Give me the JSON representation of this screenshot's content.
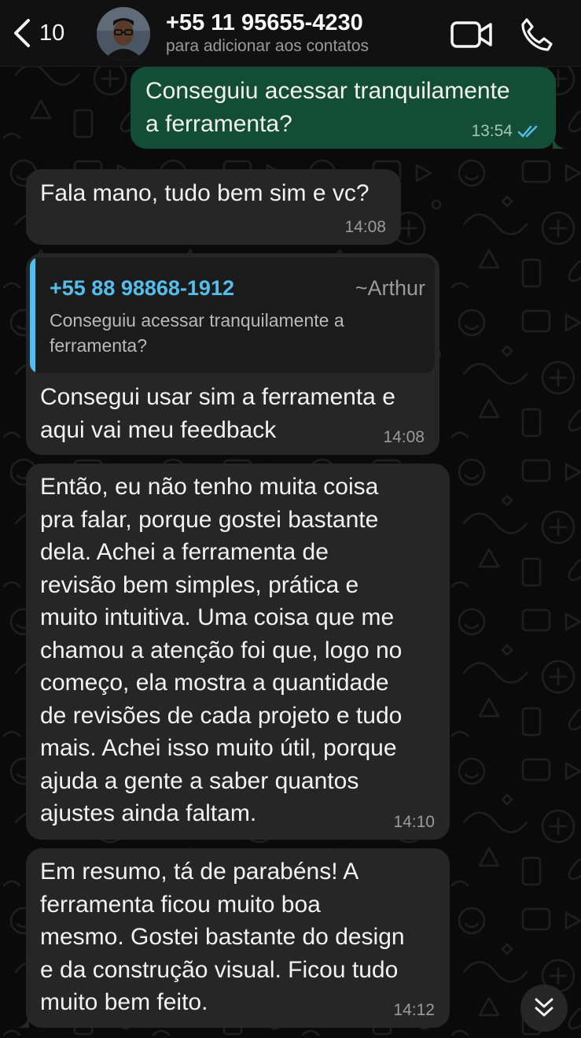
{
  "header": {
    "unread_count": "10",
    "contact_name": "+55 11 95655-4230",
    "contact_subtitle": "para adicionar aos contatos",
    "back_icon": "chevron-left-icon",
    "video_icon": "video-camera-icon",
    "call_icon": "phone-icon"
  },
  "messages": [
    {
      "direction": "out",
      "text_lines": [
        "Conseguiu acessar tranquilamente",
        "a ferramenta?"
      ],
      "time": "13:54",
      "status": "read"
    },
    {
      "direction": "in",
      "text_lines": [
        "Fala mano, tudo bem sim e vc?"
      ],
      "time": "14:08"
    },
    {
      "direction": "in",
      "quote": {
        "phone": "+55 88 98868-1912",
        "name": "~Arthur",
        "text_lines": [
          "Conseguiu acessar tranquilamente a",
          "ferramenta?"
        ]
      },
      "text_lines": [
        "Consegui usar sim a ferramenta e",
        "aqui vai meu feedback"
      ],
      "time": "14:08"
    },
    {
      "direction": "in",
      "text_lines": [
        "Então, eu não tenho muita coisa",
        "pra falar, porque gostei bastante",
        "dela. Achei a ferramenta de",
        "revisão bem simples, prática e",
        "muito intuitiva. Uma coisa que me",
        "chamou a atenção foi que, logo no",
        "começo, ela mostra a quantidade",
        "de revisões de cada projeto e tudo",
        "mais. Achei isso muito útil, porque",
        "ajuda a gente a saber quantos",
        "ajustes ainda faltam."
      ],
      "time": "14:10"
    },
    {
      "direction": "in",
      "text_lines": [
        "Em resumo, tá de parabéns! A",
        "ferramenta ficou muito boa",
        "mesmo. Gostei bastante do design",
        "e da construção visual. Ficou tudo",
        "muito bem feito."
      ],
      "time": "14:12"
    }
  ],
  "colors": {
    "background": "#0a0a0a",
    "incoming_bubble": "#262626",
    "outgoing_bubble": "#134d37",
    "accent_blue": "#53bdeb",
    "read_ticks": "#53bdeb"
  },
  "scroll_icon": "double-chevron-down-icon"
}
